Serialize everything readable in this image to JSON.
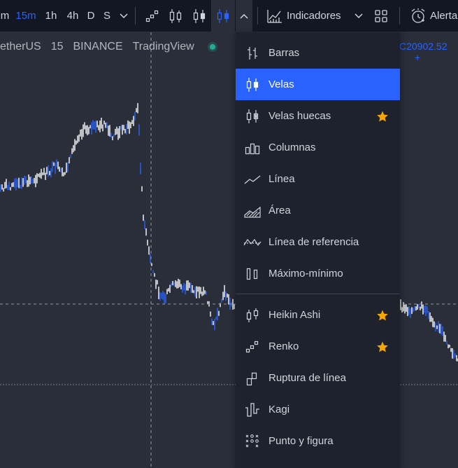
{
  "toolbar": {
    "interval_m": "m",
    "interval_15m": "15m",
    "interval_1h": "1h",
    "interval_4h": "4h",
    "interval_d": "D",
    "interval_s": "S",
    "indicators_label": "Indicadores",
    "alerts_label": "Alerta"
  },
  "legend": {
    "symbol": "etherUS",
    "interval": "15",
    "exchange": "BINANCE",
    "source": "TradingView",
    "price_fragment": "C20902.52",
    "price_suffix": "+"
  },
  "chart_type_menu": {
    "selected": "Velas",
    "items": [
      {
        "label": "Barras",
        "icon": "bars-icon",
        "favorite": false
      },
      {
        "label": "Velas",
        "icon": "candles-icon",
        "favorite": false
      },
      {
        "label": "Velas huecas",
        "icon": "hollow-candles-icon",
        "favorite": true
      },
      {
        "label": "Columnas",
        "icon": "columns-icon",
        "favorite": false
      },
      {
        "label": "Línea",
        "icon": "line-icon",
        "favorite": false
      },
      {
        "label": "Área",
        "icon": "area-icon",
        "favorite": false
      },
      {
        "label": "Línea de referencia",
        "icon": "baseline-icon",
        "favorite": false
      },
      {
        "label": "Máximo-mínimo",
        "icon": "high-low-icon",
        "favorite": false
      },
      {
        "label": "Heikin Ashi",
        "icon": "heikin-ashi-icon",
        "favorite": true
      },
      {
        "label": "Renko",
        "icon": "renko-icon",
        "favorite": true
      },
      {
        "label": "Ruptura de línea",
        "icon": "line-break-icon",
        "favorite": false
      },
      {
        "label": "Kagi",
        "icon": "kagi-icon",
        "favorite": false
      },
      {
        "label": "Punto y figura",
        "icon": "point-figure-icon",
        "favorite": false
      }
    ]
  },
  "colors": {
    "accent": "#2962ff",
    "star": "#f7a600",
    "candle_up": "#ffffff",
    "candle_down": "#2962ff"
  }
}
